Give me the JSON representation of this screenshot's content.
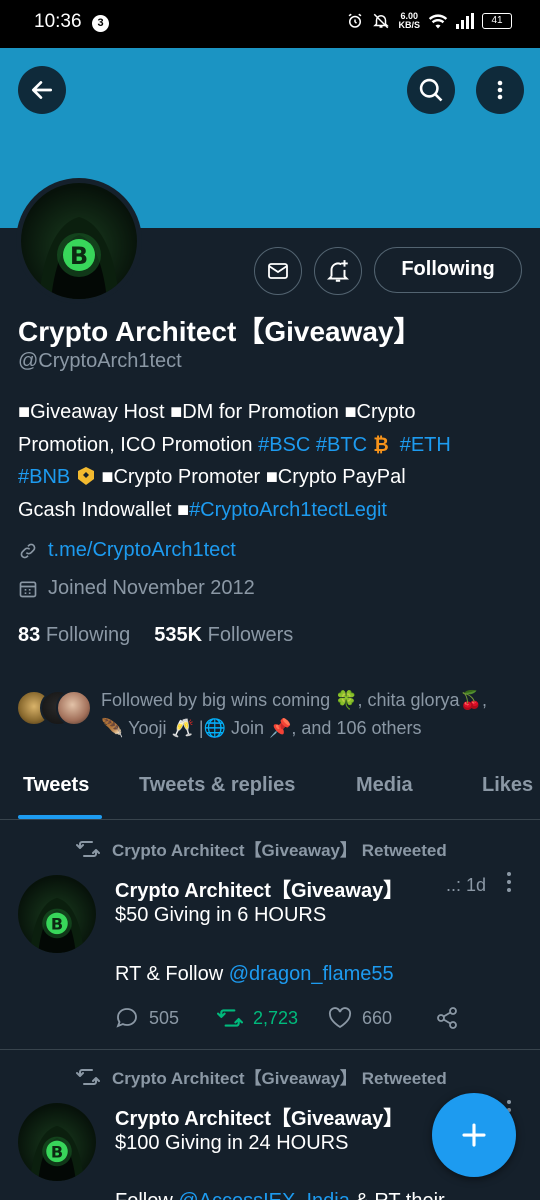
{
  "status_bar": {
    "time": "10:36",
    "notification_count": "3",
    "speed_value": "6.00",
    "speed_unit": "KB/S",
    "battery": "41"
  },
  "profile": {
    "name": "Crypto Architect【Giveaway】",
    "handle": "@CryptoArch1tect",
    "following_label": "Following",
    "bio": {
      "line1": "■Giveaway Host ■DM for Promotion ■Crypto",
      "line2_text": "Promotion, ICO Promotion ",
      "tag_bsc": "#BSC",
      "tag_btc": "#BTC",
      "tag_eth": "#ETH",
      "tag_bnb": "#BNB",
      "line3_text": " ■Crypto Promoter ■Crypto PayPal",
      "line4_text": "Gcash Indowallet ■",
      "tag_legit": "#CryptoArch1tectLegit"
    },
    "link": "t.me/CryptoArch1tect",
    "joined": "Joined November 2012",
    "following_count": "83",
    "following_word": "Following",
    "followers_count": "535K",
    "followers_word": "Followers",
    "followed_by_line1": "Followed by big wins coming 🍀, chita glorya🍒,",
    "followed_by_line2": "🪶 Yooji 🥂 |🌐 Join 📌, and 106 others"
  },
  "tabs": [
    {
      "label": "Tweets"
    },
    {
      "label": "Tweets & replies"
    },
    {
      "label": "Media"
    },
    {
      "label": "Likes"
    }
  ],
  "tweets": [
    {
      "retweet_label": "Crypto Architect【Giveaway】 Retweeted",
      "author": "Crypto Architect【Giveaway】",
      "handle_trunc": "..:",
      "time": "1d",
      "line1": "$50 Giving in 6 HOURS",
      "line2_prefix": "RT & Follow ",
      "line2_mention": "@dragon_flame55",
      "replies": "505",
      "retweets": "2,723",
      "likes": "660"
    },
    {
      "retweet_label": "Crypto Architect【Giveaway】 Retweeted",
      "author": "Crypto Architect【Giveaway】",
      "line1": "$100 Giving in 24 HOURS",
      "line2_prefix": "Follow ",
      "line2_mention": "@AccessIEX_India",
      "line2_suffix": " & RT their"
    }
  ],
  "colors": {
    "banner": "#1b94c3",
    "background": "#15202b",
    "accent": "#1d9bf0",
    "retweet_green": "#00ba7c",
    "muted": "#8b98a5"
  }
}
